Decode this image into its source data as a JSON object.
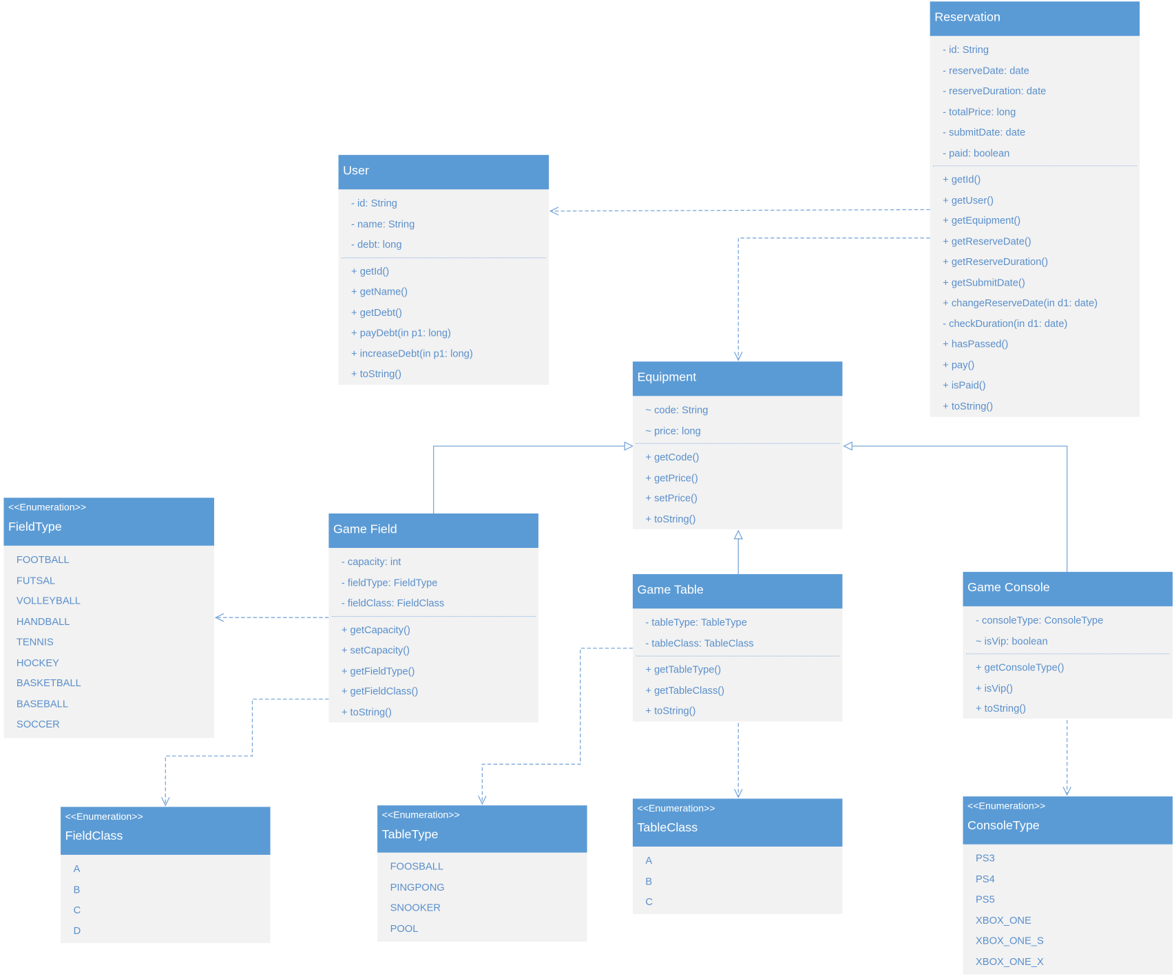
{
  "colors": {
    "header": "#5b9bd5",
    "body": "#f2f2f2",
    "text": "#5a8fcb",
    "connector": "#7aa7d9"
  },
  "classes": [
    {
      "id": "reservation",
      "name": "Reservation",
      "attributes": [
        "- id: String",
        "- reserveDate: date",
        "- reserveDuration: date",
        "- totalPrice: long",
        "- submitDate: date",
        "- paid: boolean"
      ],
      "methods": [
        "+ getId()",
        "+ getUser()",
        "+ getEquipment()",
        "+ getReserveDate()",
        "+ getReserveDuration()",
        "+ getSubmitDate()",
        "+ changeReserveDate(in d1: date)",
        "- checkDuration(in d1: date)",
        "+ hasPassed()",
        "+ pay()",
        "+ isPaid()",
        "+ toString()"
      ]
    },
    {
      "id": "user",
      "name": "User",
      "attributes": [
        "- id: String",
        "- name: String",
        "- debt: long"
      ],
      "methods": [
        "+ getId()",
        "+ getName()",
        "+ getDebt()",
        "+ payDebt(in p1: long)",
        "+ increaseDebt(in p1: long)",
        "+ toString()"
      ]
    },
    {
      "id": "equipment",
      "name": "Equipment",
      "attributes": [
        "~ code: String",
        "~ price: long"
      ],
      "methods": [
        "+ getCode()",
        "+ getPrice()",
        "+ setPrice()",
        "+ toString()"
      ]
    },
    {
      "id": "field-type",
      "stereotype": "<<Enumeration>>",
      "name": "FieldType",
      "literals": [
        "FOOTBALL",
        "FUTSAL",
        "VOLLEYBALL",
        "HANDBALL",
        "TENNIS",
        "HOCKEY",
        "BASKETBALL",
        "BASEBALL",
        "SOCCER"
      ]
    },
    {
      "id": "game-field",
      "name": "Game Field",
      "attributes": [
        "- capacity: int",
        "- fieldType: FieldType",
        "- fieldClass: FieldClass"
      ],
      "methods": [
        "+ getCapacity()",
        "+ setCapacity()",
        "+ getFieldType()",
        "+ getFieldClass()",
        "+ toString()"
      ]
    },
    {
      "id": "game-table",
      "name": "Game Table",
      "attributes": [
        "- tableType: TableType",
        "- tableClass: TableClass"
      ],
      "methods": [
        "+ getTableType()",
        "+ getTableClass()",
        "+ toString()"
      ]
    },
    {
      "id": "game-console",
      "name": "Game Console",
      "attributes": [
        "- consoleType: ConsoleType",
        "~ isVip: boolean"
      ],
      "methods": [
        "+ getConsoleType()",
        "+ isVip()",
        "+ toString()"
      ]
    },
    {
      "id": "field-class",
      "stereotype": "<<Enumeration>>",
      "name": "FieldClass",
      "literals": [
        "A",
        "B",
        "C",
        "D"
      ]
    },
    {
      "id": "table-type",
      "stereotype": "<<Enumeration>>",
      "name": "TableType",
      "literals": [
        "FOOSBALL",
        "PINGPONG",
        "SNOOKER",
        "POOL"
      ]
    },
    {
      "id": "table-class",
      "stereotype": "<<Enumeration>>",
      "name": "TableClass",
      "literals": [
        "A",
        "B",
        "C"
      ]
    },
    {
      "id": "console-type",
      "stereotype": "<<Enumeration>>",
      "name": "ConsoleType",
      "literals": [
        "PS3",
        "PS4",
        "PS5",
        "XBOX_ONE",
        "XBOX_ONE_S",
        "XBOX_ONE_X"
      ]
    }
  ],
  "relations": [
    {
      "from": "reservation",
      "to": "user",
      "type": "dependency"
    },
    {
      "from": "reservation",
      "to": "equipment",
      "type": "dependency"
    },
    {
      "from": "game-field",
      "to": "equipment",
      "type": "generalization"
    },
    {
      "from": "game-table",
      "to": "equipment",
      "type": "generalization"
    },
    {
      "from": "game-console",
      "to": "equipment",
      "type": "generalization"
    },
    {
      "from": "game-field",
      "to": "field-type",
      "type": "dependency"
    },
    {
      "from": "game-field",
      "to": "field-class",
      "type": "dependency"
    },
    {
      "from": "game-table",
      "to": "table-type",
      "type": "dependency"
    },
    {
      "from": "game-table",
      "to": "table-class",
      "type": "dependency"
    },
    {
      "from": "game-console",
      "to": "console-type",
      "type": "dependency"
    }
  ]
}
